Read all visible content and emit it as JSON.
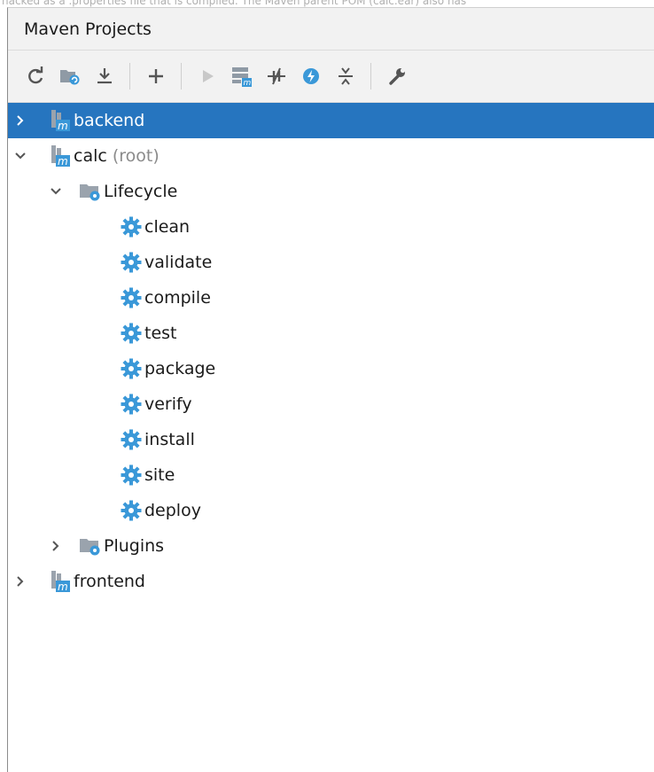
{
  "window": {
    "cut_top_text": "hacked as a .properties file that is compiled. The Maven parent POM (calc.ear) also has"
  },
  "panel": {
    "title": "Maven Projects"
  },
  "toolbar": {
    "buttons": [
      {
        "icon": "refresh-icon"
      },
      {
        "icon": "generate-sources-icon"
      },
      {
        "icon": "download-icon"
      },
      {
        "icon": "add-icon"
      },
      {
        "icon": "run-icon"
      },
      {
        "icon": "execute-goal-icon"
      },
      {
        "icon": "toggle-offline-icon"
      },
      {
        "icon": "skip-tests-icon"
      },
      {
        "icon": "collapse-all-icon"
      },
      {
        "icon": "settings-wrench-icon"
      }
    ]
  },
  "tree": {
    "backend": {
      "label": "backend"
    },
    "calc": {
      "label": "calc",
      "suffix": "(root)"
    },
    "lifecycle": {
      "label": "Lifecycle"
    },
    "goals": [
      "clean",
      "validate",
      "compile",
      "test",
      "package",
      "verify",
      "install",
      "site",
      "deploy"
    ],
    "plugins": {
      "label": "Plugins"
    },
    "frontend": {
      "label": "frontend"
    }
  },
  "colors": {
    "selection": "#2675bf",
    "gear": "#3a98d8",
    "header_bg": "#f2f2f2"
  }
}
